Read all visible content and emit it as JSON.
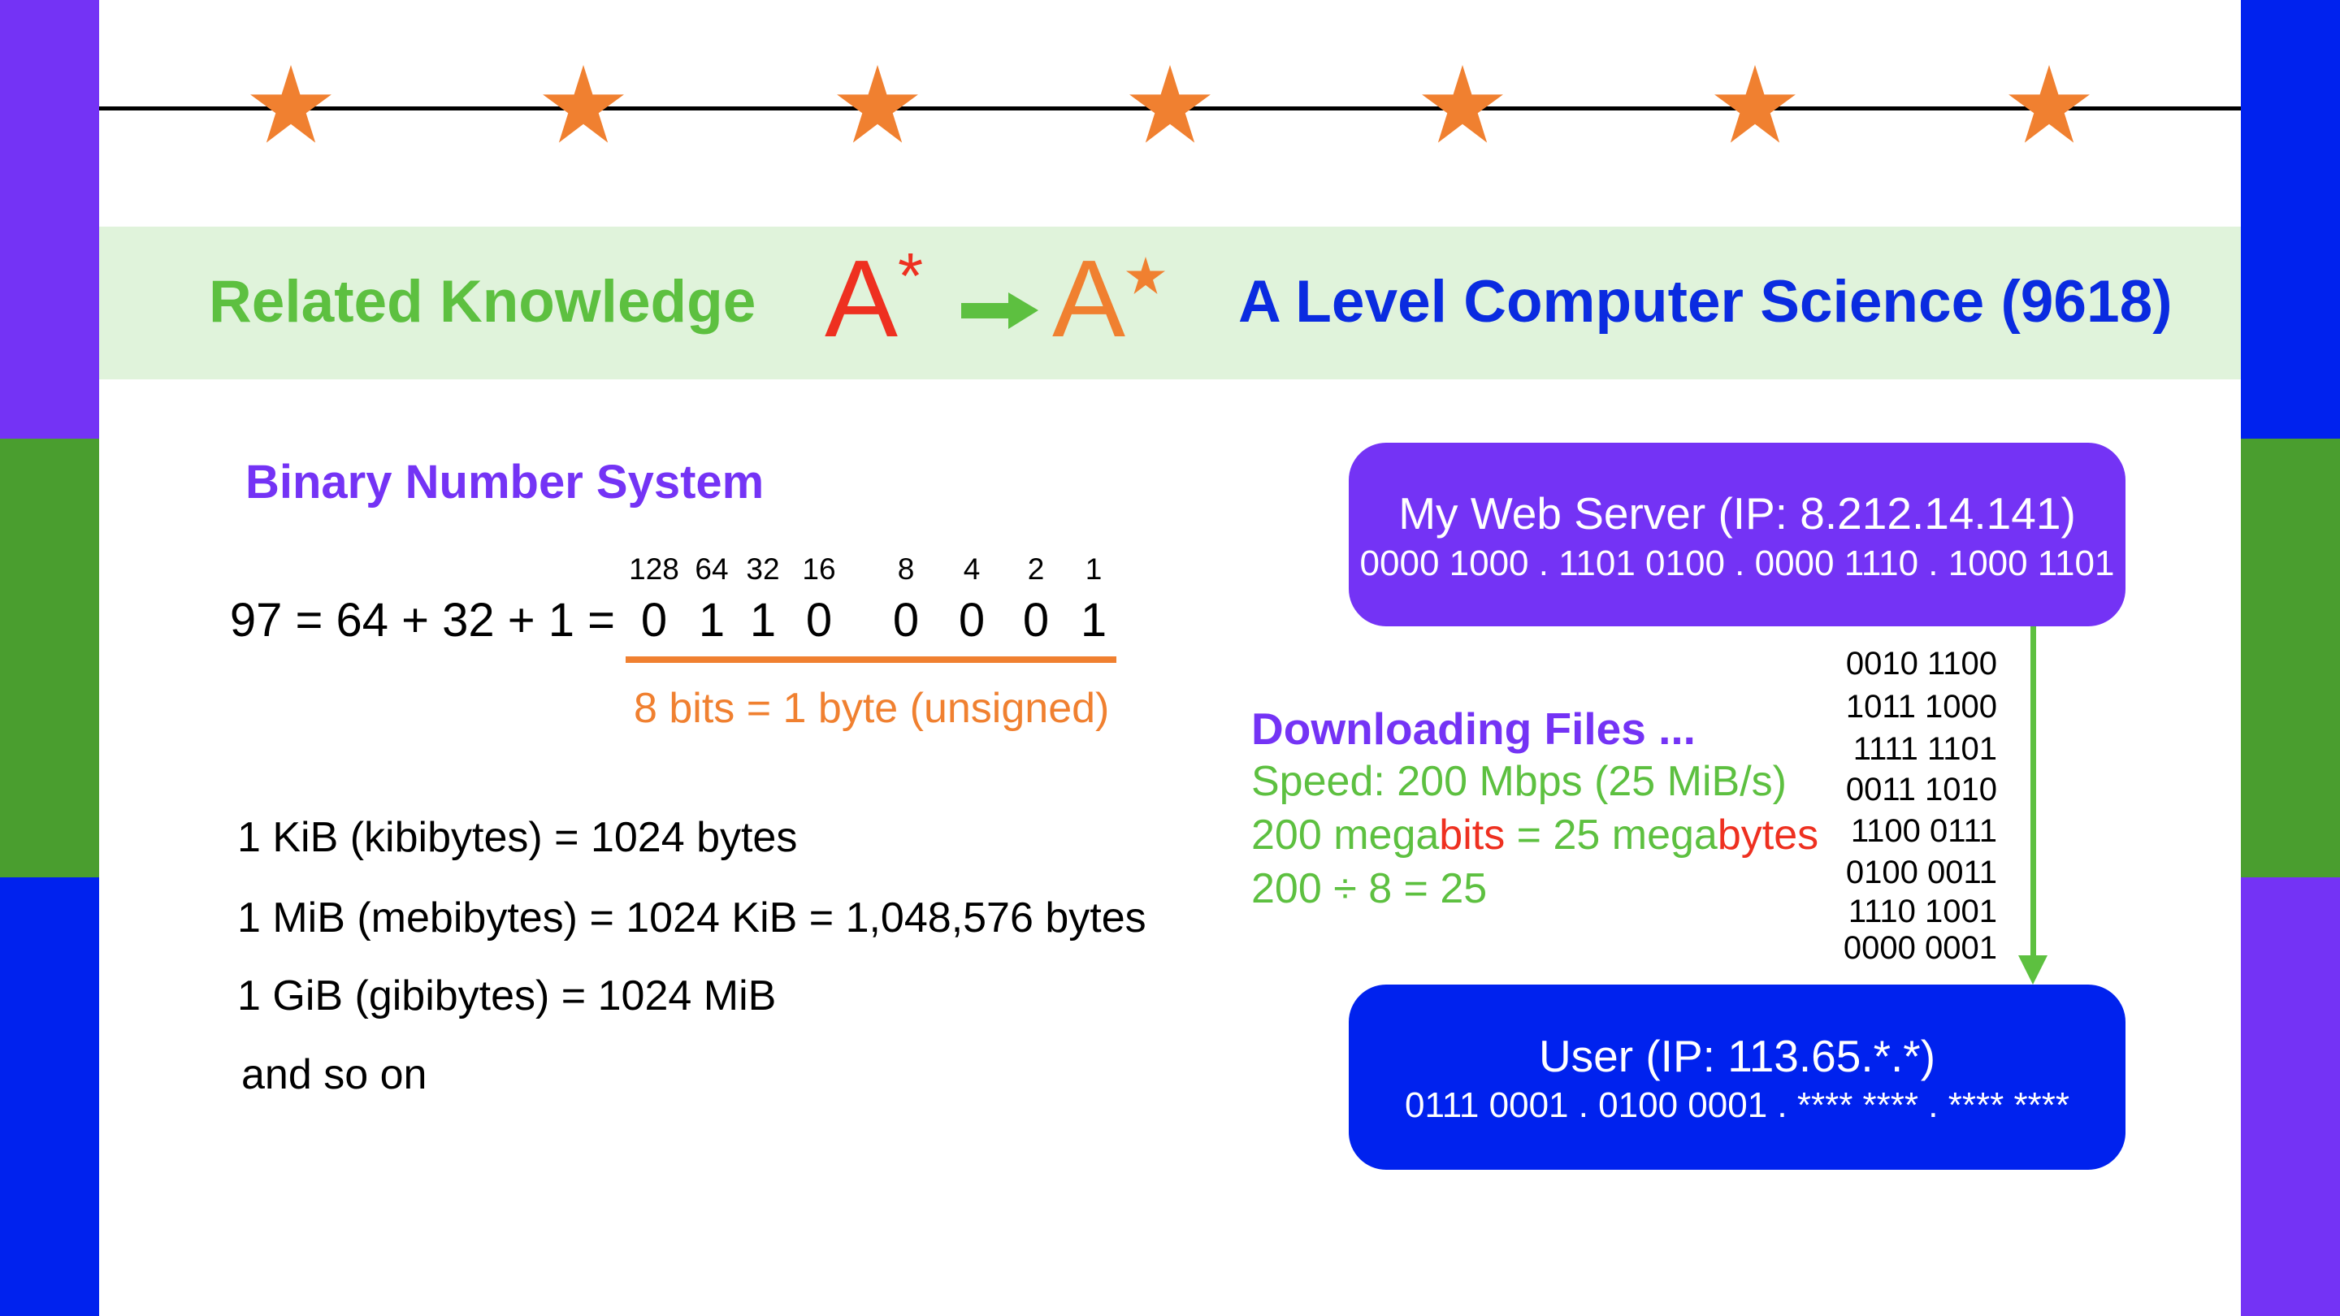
{
  "colors": {
    "purple": "#7433F5",
    "green": "#4A9E2F",
    "blue": "#0022EE",
    "orange": "#F08030",
    "light_green": "#E0F3DB",
    "text_green": "#5DC040",
    "red": "#EE3020"
  },
  "banner": {
    "left": "Related Knowledge",
    "grade_from": "A",
    "grade_to": "A",
    "star": "*",
    "right": "A Level Computer Science (9618)"
  },
  "binary": {
    "heading": "Binary Number System",
    "weights": [
      "128",
      "64",
      "32",
      "16",
      "8",
      "4",
      "2",
      "1"
    ],
    "equation": "97 = 64 + 32 + 1 =",
    "bits": [
      "0",
      "1",
      "1",
      "0",
      "0",
      "0",
      "0",
      "1"
    ],
    "note": "8 bits = 1 byte (unsigned)"
  },
  "units": [
    "1 KiB (kibibytes) = 1024 bytes",
    "1 MiB (mebibytes) = 1024 KiB = 1,048,576 bytes",
    "1 GiB (gibibytes) = 1024 MiB",
    "and so on"
  ],
  "server": {
    "title": "My Web Server (IP: 8.212.14.141)",
    "binary": "0000 1000 . 1101 0100 . 0000 1110 . 1000 1101"
  },
  "user": {
    "title": "User (IP: 113.65.*.*)",
    "binary": "0111 0001 . 0100 0001 . **** **** . **** ****"
  },
  "download": {
    "heading": "Downloading Files ...",
    "speed": "Speed: 200 Mbps (25 MiB/s)",
    "l2a": "200 mega",
    "l2b": "bits",
    "l2c": " = 25 mega",
    "l2d": "bytes",
    "calc": "200 ÷ 8 = 25"
  },
  "stream": [
    "0010 1100",
    "1011 1000",
    "1111 1101",
    "0011 1010",
    "1100 0111",
    "0100 0011",
    "1110 1001",
    "0000 0001"
  ]
}
